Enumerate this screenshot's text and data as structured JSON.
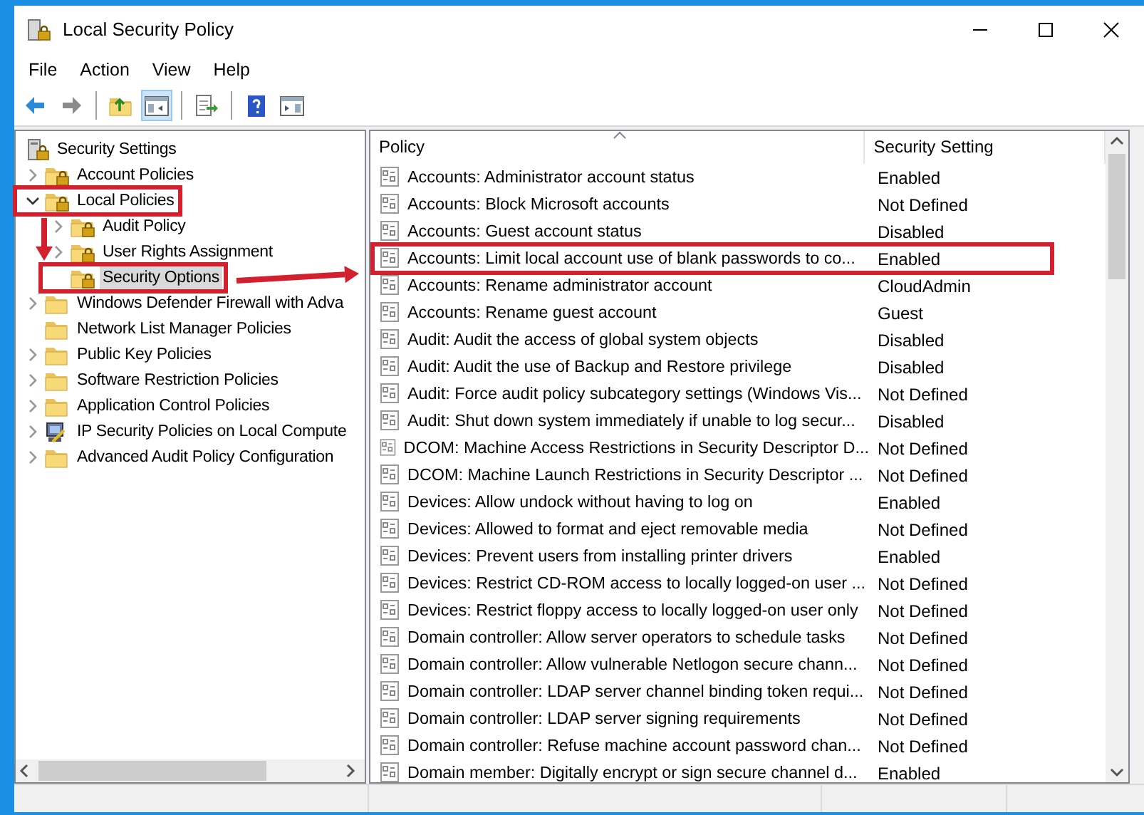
{
  "window": {
    "title": "Local Security Policy"
  },
  "menu": [
    "File",
    "Action",
    "View",
    "Help"
  ],
  "toolbar": [
    {
      "kind": "back"
    },
    {
      "kind": "forward"
    },
    {
      "kind": "separator"
    },
    {
      "kind": "up"
    },
    {
      "kind": "tree",
      "selected": true
    },
    {
      "kind": "separator"
    },
    {
      "kind": "export"
    },
    {
      "kind": "separator"
    },
    {
      "kind": "help"
    },
    {
      "kind": "pane"
    }
  ],
  "tree": [
    {
      "label": "Security Settings",
      "kind": "root",
      "selected": false,
      "children": [
        {
          "label": "Account Policies",
          "kind": "locked",
          "expandable": true,
          "expanded": false,
          "selected": false,
          "highlighted": false
        },
        {
          "label": "Local Policies",
          "kind": "locked",
          "expandable": true,
          "expanded": true,
          "selected": false,
          "highlighted": true,
          "children": [
            {
              "label": "Audit Policy",
              "kind": "locked",
              "expandable": true,
              "expanded": false,
              "selected": false,
              "highlighted": false
            },
            {
              "label": "User Rights Assignment",
              "kind": "locked",
              "expandable": true,
              "expanded": false,
              "selected": false,
              "highlighted": false
            },
            {
              "label": "Security Options",
              "kind": "locked",
              "expandable": false,
              "selected": true,
              "highlighted": true
            }
          ]
        },
        {
          "label": "Windows Defender Firewall with Adva",
          "kind": "folder",
          "expandable": true,
          "expanded": false,
          "selected": false,
          "highlighted": false
        },
        {
          "label": "Network List Manager Policies",
          "kind": "folder",
          "expandable": false,
          "selected": false,
          "highlighted": false
        },
        {
          "label": "Public Key Policies",
          "kind": "folder",
          "expandable": true,
          "expanded": false,
          "selected": false,
          "highlighted": false
        },
        {
          "label": "Software Restriction Policies",
          "kind": "folder",
          "expandable": true,
          "expanded": false,
          "selected": false,
          "highlighted": false
        },
        {
          "label": "Application Control Policies",
          "kind": "folder",
          "expandable": true,
          "expanded": false,
          "selected": false,
          "highlighted": false
        },
        {
          "label": "IP Security Policies on Local Compute",
          "kind": "network",
          "expandable": true,
          "expanded": false,
          "selected": false,
          "highlighted": false
        },
        {
          "label": "Advanced Audit Policy Configuration",
          "kind": "folder",
          "expandable": true,
          "expanded": false,
          "selected": false,
          "highlighted": false
        }
      ]
    }
  ],
  "table": {
    "columns": [
      "Policy",
      "Security Setting"
    ],
    "rows": [
      {
        "policy": "Accounts: Administrator account status",
        "setting": "Enabled",
        "highlighted": false
      },
      {
        "policy": "Accounts: Block Microsoft accounts",
        "setting": "Not Defined",
        "highlighted": false
      },
      {
        "policy": "Accounts: Guest account status",
        "setting": "Disabled",
        "highlighted": false
      },
      {
        "policy": "Accounts: Limit local account use of blank passwords to co...",
        "setting": "Enabled",
        "highlighted": true
      },
      {
        "policy": "Accounts: Rename administrator account",
        "setting": "CloudAdmin",
        "highlighted": false
      },
      {
        "policy": "Accounts: Rename guest account",
        "setting": "Guest",
        "highlighted": false
      },
      {
        "policy": "Audit: Audit the access of global system objects",
        "setting": "Disabled",
        "highlighted": false
      },
      {
        "policy": "Audit: Audit the use of Backup and Restore privilege",
        "setting": "Disabled",
        "highlighted": false
      },
      {
        "policy": "Audit: Force audit policy subcategory settings (Windows Vis...",
        "setting": "Not Defined",
        "highlighted": false
      },
      {
        "policy": "Audit: Shut down system immediately if unable to log secur...",
        "setting": "Disabled",
        "highlighted": false
      },
      {
        "policy": "DCOM: Machine Access Restrictions in Security Descriptor D...",
        "setting": "Not Defined",
        "highlighted": false
      },
      {
        "policy": "DCOM: Machine Launch Restrictions in Security Descriptor ...",
        "setting": "Not Defined",
        "highlighted": false
      },
      {
        "policy": "Devices: Allow undock without having to log on",
        "setting": "Enabled",
        "highlighted": false
      },
      {
        "policy": "Devices: Allowed to format and eject removable media",
        "setting": "Not Defined",
        "highlighted": false
      },
      {
        "policy": "Devices: Prevent users from installing printer drivers",
        "setting": "Enabled",
        "highlighted": false
      },
      {
        "policy": "Devices: Restrict CD-ROM access to locally logged-on user ...",
        "setting": "Not Defined",
        "highlighted": false
      },
      {
        "policy": "Devices: Restrict floppy access to locally logged-on user only",
        "setting": "Not Defined",
        "highlighted": false
      },
      {
        "policy": "Domain controller: Allow server operators to schedule tasks",
        "setting": "Not Defined",
        "highlighted": false
      },
      {
        "policy": "Domain controller: Allow vulnerable Netlogon secure chann...",
        "setting": "Not Defined",
        "highlighted": false
      },
      {
        "policy": "Domain controller: LDAP server channel binding token requi...",
        "setting": "Not Defined",
        "highlighted": false
      },
      {
        "policy": "Domain controller: LDAP server signing requirements",
        "setting": "Not Defined",
        "highlighted": false
      },
      {
        "policy": "Domain controller: Refuse machine account password chan...",
        "setting": "Not Defined",
        "highlighted": false
      },
      {
        "policy": "Domain member: Digitally encrypt or sign secure channel d...",
        "setting": "Enabled",
        "highlighted": false
      }
    ]
  }
}
